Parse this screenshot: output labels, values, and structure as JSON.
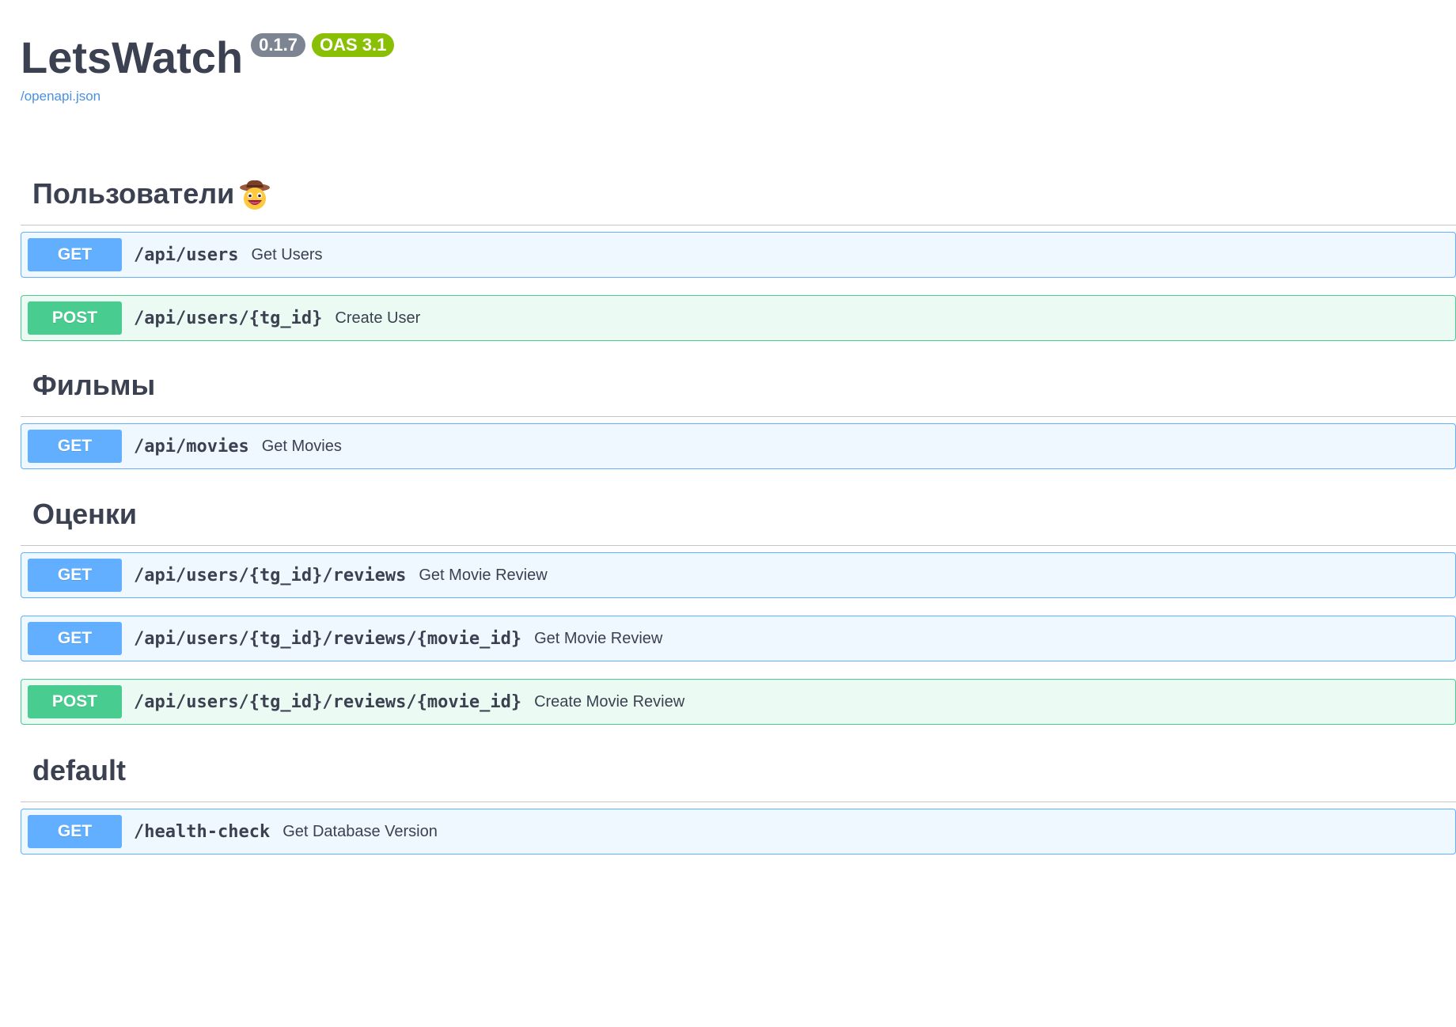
{
  "info": {
    "title": "LetsWatch",
    "version": "0.1.7",
    "oas": "OAS 3.1",
    "spec_link": "/openapi.json"
  },
  "colors": {
    "get": "#61affe",
    "post": "#49cc90",
    "version_badge": "#7d8492",
    "oas_badge": "#89bf04",
    "link": "#4990e2"
  },
  "sections": [
    {
      "name": "Пользователи",
      "icon": "cowboy-face-emoji",
      "operations": [
        {
          "method": "GET",
          "path": "/api/users",
          "summary": "Get Users"
        },
        {
          "method": "POST",
          "path": "/api/users/{tg_id}",
          "summary": "Create User"
        }
      ]
    },
    {
      "name": "Фильмы",
      "operations": [
        {
          "method": "GET",
          "path": "/api/movies",
          "summary": "Get Movies"
        }
      ]
    },
    {
      "name": "Оценки",
      "operations": [
        {
          "method": "GET",
          "path": "/api/users/{tg_id}/reviews",
          "summary": "Get Movie Review"
        },
        {
          "method": "GET",
          "path": "/api/users/{tg_id}/reviews/{movie_id}",
          "summary": "Get Movie Review"
        },
        {
          "method": "POST",
          "path": "/api/users/{tg_id}/reviews/{movie_id}",
          "summary": "Create Movie Review"
        }
      ]
    },
    {
      "name": "default",
      "operations": [
        {
          "method": "GET",
          "path": "/health-check",
          "summary": "Get Database Version"
        }
      ]
    }
  ]
}
